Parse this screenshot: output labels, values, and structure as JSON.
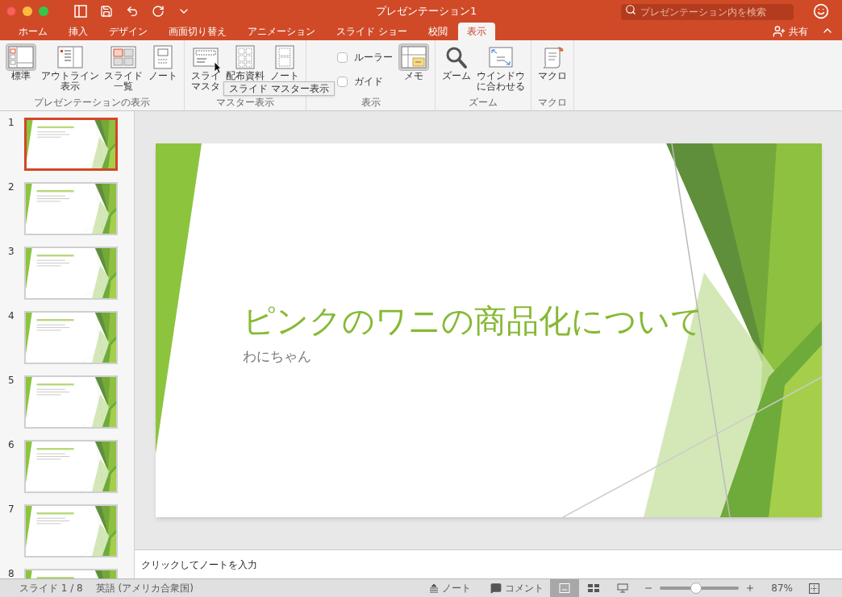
{
  "window": {
    "title": "プレゼンテーション1",
    "search_placeholder": "プレゼンテーション内を検索"
  },
  "tabs": [
    {
      "label": "ホーム",
      "selected": false
    },
    {
      "label": "挿入",
      "selected": false
    },
    {
      "label": "デザイン",
      "selected": false
    },
    {
      "label": "画面切り替え",
      "selected": false
    },
    {
      "label": "アニメーション",
      "selected": false
    },
    {
      "label": "スライド ショー",
      "selected": false
    },
    {
      "label": "校閲",
      "selected": false
    },
    {
      "label": "表示",
      "selected": true
    }
  ],
  "share": "共有",
  "ribbon": [
    {
      "group": "プレゼンテーションの表示",
      "items": [
        {
          "kind": "button",
          "lines": [
            "標準"
          ],
          "selected": true
        },
        {
          "kind": "button",
          "lines": [
            "アウトライン",
            "表示"
          ],
          "selected": false
        },
        {
          "kind": "button",
          "lines": [
            "スライド",
            "一覧"
          ],
          "selected": false
        },
        {
          "kind": "button",
          "lines": [
            "ノート"
          ],
          "selected": false
        }
      ]
    },
    {
      "group": "マスター表示",
      "items": [
        {
          "kind": "button",
          "lines": [
            "スライ",
            "マスタ"
          ],
          "selected": false
        },
        {
          "kind": "button",
          "lines": [
            "配布資料"
          ],
          "selected": false
        },
        {
          "kind": "button",
          "lines": [
            "ノート"
          ],
          "selected": false
        }
      ]
    },
    {
      "group": "表示",
      "items": [
        {
          "kind": "checks",
          "checks": [
            {
              "label": "ルーラー",
              "checked": false
            },
            {
              "label": "ガイド",
              "checked": false
            }
          ]
        },
        {
          "kind": "button",
          "lines": [
            "メモ"
          ],
          "selected": true
        }
      ]
    },
    {
      "group": "ズーム",
      "items": [
        {
          "kind": "button",
          "lines": [
            "ズーム"
          ],
          "selected": false
        },
        {
          "kind": "button",
          "lines": [
            "ウインドウ",
            "に合わせる"
          ],
          "selected": false
        }
      ]
    },
    {
      "group": "マクロ",
      "items": [
        {
          "kind": "button",
          "lines": [
            "マクロ"
          ],
          "selected": false
        }
      ]
    }
  ],
  "tooltip": "スライド マスター表示",
  "thumbnails": [
    {
      "number": "1",
      "selected": true
    },
    {
      "number": "2",
      "selected": false
    },
    {
      "number": "3",
      "selected": false
    },
    {
      "number": "4",
      "selected": false
    },
    {
      "number": "5",
      "selected": false
    },
    {
      "number": "6",
      "selected": false
    },
    {
      "number": "7",
      "selected": false
    },
    {
      "number": "8",
      "selected": false
    }
  ],
  "slide": {
    "title": "ピンクのワニの商品化について",
    "subtitle": "わにちゃん"
  },
  "notes_placeholder": "クリックしてノートを入力",
  "status_bar": {
    "slide": "スライド 1 / 8",
    "language": "英語 (アメリカ合衆国)",
    "notes": "ノート",
    "comments": "コメント",
    "views": [
      {
        "selected": true
      },
      {
        "selected": false
      },
      {
        "selected": false
      }
    ],
    "zoom": {
      "level": 0.45
    },
    "zoom_reading": "87%"
  }
}
